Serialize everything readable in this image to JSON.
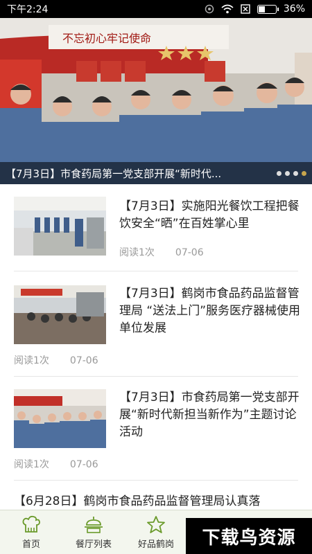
{
  "status_bar": {
    "time": "下午2:24",
    "battery": "36%",
    "battery_level": 0.36
  },
  "banner": {
    "caption": "【7月3日】市食药局第一党支部开展“新时代...",
    "slogan": "不忘初心牢记使命",
    "slide_count": 4,
    "active_slide": 4
  },
  "news": [
    {
      "title": "【7月3日】实施阳光餐饮工程把餐饮安全“晒”在百姓掌心里",
      "reads": "阅读1次",
      "date": "07-06"
    },
    {
      "title": "【7月3日】鹤岗市食品药品监督管理局 “送法上门”服务医疗器械使用单位发展",
      "reads": "阅读1次",
      "date": "07-06"
    },
    {
      "title": "【7月3日】市食药局第一党支部开展“新时代新担当新作为”主题讨论活动",
      "reads": "阅读1次",
      "date": "07-06"
    },
    {
      "title": "【6月28日】鹤岗市食品药品监督管理局认真落"
    }
  ],
  "nav": [
    {
      "label": "首页",
      "icon": "home-chef-hat-icon"
    },
    {
      "label": "餐厅列表",
      "icon": "restaurant-cloche-icon"
    },
    {
      "label": "好品鹤岗",
      "icon": "star-icon"
    }
  ],
  "watermark": "下载鸟资源",
  "colors": {
    "accent": "#6a9a2a",
    "nav_bg": "#f3f6ee",
    "caption_bg": "#000000"
  }
}
